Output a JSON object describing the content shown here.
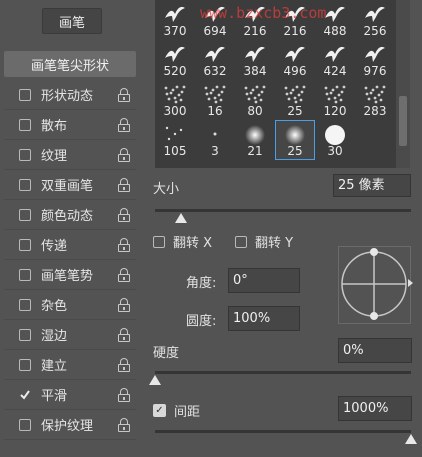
{
  "panel": {
    "brush_button": "画笔",
    "tip_shape_header": "画笔笔尖形状"
  },
  "options": [
    {
      "label": "形状动态",
      "checked": false
    },
    {
      "label": "散布",
      "checked": false
    },
    {
      "label": "纹理",
      "checked": false
    },
    {
      "label": "双重画笔",
      "checked": false
    },
    {
      "label": "颜色动态",
      "checked": false
    },
    {
      "label": "传递",
      "checked": false
    },
    {
      "label": "画笔笔势",
      "checked": false
    },
    {
      "label": "杂色",
      "checked": false
    },
    {
      "label": "湿边",
      "checked": false
    },
    {
      "label": "建立",
      "checked": false
    },
    {
      "label": "平滑",
      "checked": true
    },
    {
      "label": "保护纹理",
      "checked": false
    }
  ],
  "brushes": [
    {
      "size": "370",
      "kind": "bird-icon"
    },
    {
      "size": "694",
      "kind": "bird-icon"
    },
    {
      "size": "216",
      "kind": "bird-icon"
    },
    {
      "size": "216",
      "kind": "bird-icon"
    },
    {
      "size": "488",
      "kind": "bird-icon"
    },
    {
      "size": "256",
      "kind": "bird-icon"
    },
    {
      "size": "520",
      "kind": "bird-icon"
    },
    {
      "size": "632",
      "kind": "bird-icon"
    },
    {
      "size": "384",
      "kind": "bird-icon"
    },
    {
      "size": "496",
      "kind": "bird-icon"
    },
    {
      "size": "424",
      "kind": "bird-icon"
    },
    {
      "size": "976",
      "kind": "bird-icon"
    },
    {
      "size": "300",
      "kind": "scatter-texture-icon"
    },
    {
      "size": "16",
      "kind": "scatter-texture-icon"
    },
    {
      "size": "80",
      "kind": "scatter-texture-icon"
    },
    {
      "size": "25",
      "kind": "scatter-texture-icon"
    },
    {
      "size": "120",
      "kind": "scatter-texture-icon"
    },
    {
      "size": "283",
      "kind": "scatter-texture-icon"
    },
    {
      "size": "105",
      "kind": "dots-icon"
    },
    {
      "size": "3",
      "kind": "dot-icon"
    },
    {
      "size": "21",
      "kind": "soft-round-icon"
    },
    {
      "size": "25",
      "kind": "soft-round-icon",
      "selected": true
    },
    {
      "size": "30",
      "kind": "hard-round-icon"
    }
  ],
  "watermark": "www.bzxcb3.com",
  "size": {
    "label": "大小",
    "value": "25 像素",
    "fraction": 0.1
  },
  "flip": {
    "x_label": "翻转 X",
    "y_label": "翻转 Y"
  },
  "angle": {
    "label": "角度:",
    "value": "0°"
  },
  "roundness": {
    "label": "圆度:",
    "value": "100%"
  },
  "hardness": {
    "label": "硬度",
    "value": "0%",
    "fraction": 0.0
  },
  "spacing": {
    "label": "间距",
    "value": "1000%",
    "checked": true,
    "fraction": 1.0
  },
  "colors": {
    "accent": "#4a9ee8",
    "panel_bg": "#535353",
    "grid_bg": "#3c3c3c",
    "field_bg": "#464646"
  }
}
